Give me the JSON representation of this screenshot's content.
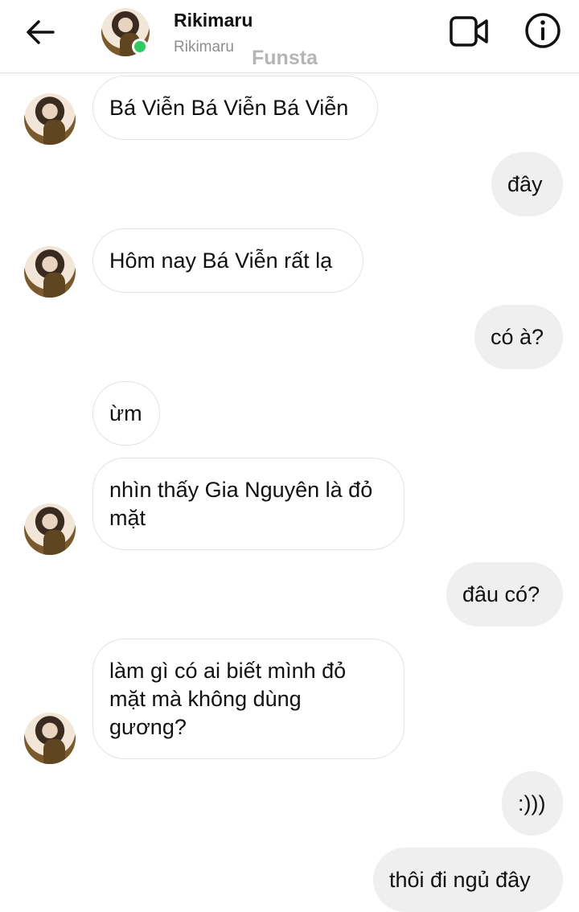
{
  "header": {
    "name": "Rikimaru",
    "subtitle": "Rikimaru",
    "watermark": "Funsta",
    "icons": [
      "back-arrow-icon",
      "video-call-icon",
      "info-icon"
    ],
    "online_color": "#2ecc5f"
  },
  "messages": [
    {
      "from": "them",
      "text": "Bá Viễn Bá Viễn Bá Viễn"
    },
    {
      "from": "me",
      "text": "đây"
    },
    {
      "from": "them",
      "text": "Hôm nay Bá Viễn rất lạ"
    },
    {
      "from": "me",
      "text": "có à?"
    },
    {
      "from": "them",
      "text": "ừm"
    },
    {
      "from": "them",
      "text": "nhìn thấy Gia Nguyên là đỏ mặt"
    },
    {
      "from": "me",
      "text": "đâu có?"
    },
    {
      "from": "them",
      "text": "làm gì có ai biết mình đỏ mặt mà không dùng gương?"
    },
    {
      "from": "me",
      "text": ":)))"
    },
    {
      "from": "me",
      "text": "thôi đi ngủ đây"
    }
  ]
}
